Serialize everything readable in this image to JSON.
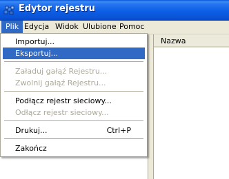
{
  "window": {
    "title": "Edytor rejestru",
    "icon": "regedit-icon"
  },
  "menubar": {
    "items": [
      {
        "label": "Plik",
        "active": true
      },
      {
        "label": "Edycja"
      },
      {
        "label": "Widok"
      },
      {
        "label": "Ulubione"
      },
      {
        "label": "Pomoc"
      }
    ]
  },
  "list": {
    "columns": [
      "Nazwa"
    ]
  },
  "file_menu": {
    "items": [
      {
        "label": "Importuj...",
        "enabled": true
      },
      {
        "label": "Eksportuj...",
        "enabled": true,
        "highlighted": true
      },
      {
        "label": "Załaduj gałąź Rejestru...",
        "enabled": false
      },
      {
        "label": "Zwolnij gałąź Rejestru...",
        "enabled": false
      },
      {
        "label": "Podłącz rejestr sieciowy...",
        "enabled": true
      },
      {
        "label": "Odłącz rejestr sieciowy...",
        "enabled": false
      },
      {
        "label": "Drukuj...",
        "enabled": true,
        "shortcut": "Ctrl+P"
      },
      {
        "label": "Zakończ",
        "enabled": true
      }
    ]
  },
  "colors": {
    "titlebar": "#0a5ce5",
    "highlight": "#316ac5",
    "disabled_text": "#aca899",
    "menu_bg": "#ece9d8"
  }
}
